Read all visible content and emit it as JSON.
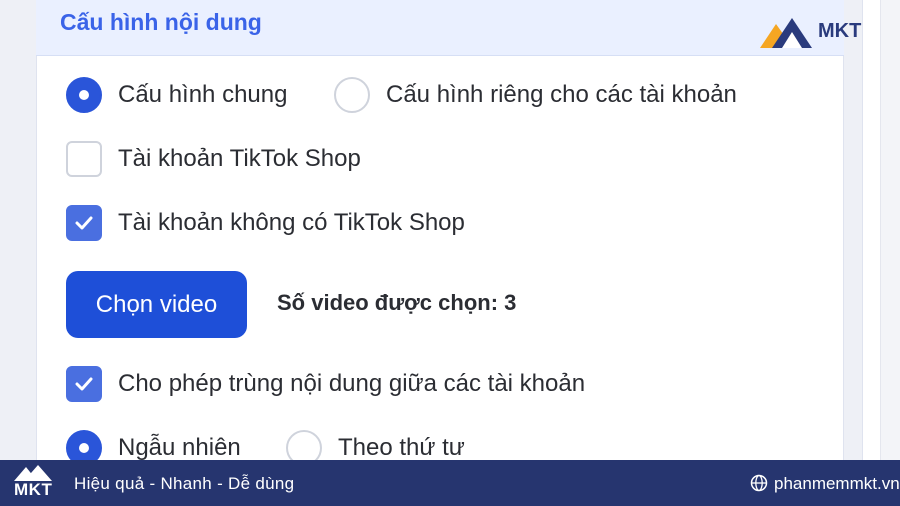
{
  "panel": {
    "title": "Cấu hình nội dung"
  },
  "config_mode": {
    "options": [
      {
        "label": "Cấu hình chung",
        "selected": true
      },
      {
        "label": "Cấu hình riêng cho các tài khoản",
        "selected": false
      }
    ]
  },
  "accounts": {
    "tiktok_shop": {
      "label": "Tài khoản TikTok Shop",
      "checked": false
    },
    "no_tiktok_shop": {
      "label": "Tài khoản không có TikTok Shop",
      "checked": true
    }
  },
  "video": {
    "button_label": "Chọn video",
    "count_text": "Số video được chọn: 3"
  },
  "duplicate": {
    "label": "Cho phép trùng nội dung giữa các tài khoản",
    "checked": true
  },
  "order_mode": {
    "options": [
      {
        "label": "Ngẫu nhiên",
        "selected": true
      },
      {
        "label": "Theo thứ tư",
        "selected": false
      }
    ]
  },
  "branding": {
    "logo_text": "MKT",
    "tagline": "Hiệu quả - Nhanh  - Dễ dùng",
    "website": "phanmemmkt.vn"
  },
  "colors": {
    "accent": "#1e4fd8",
    "title": "#3a63e8",
    "footer": "#26356f"
  }
}
